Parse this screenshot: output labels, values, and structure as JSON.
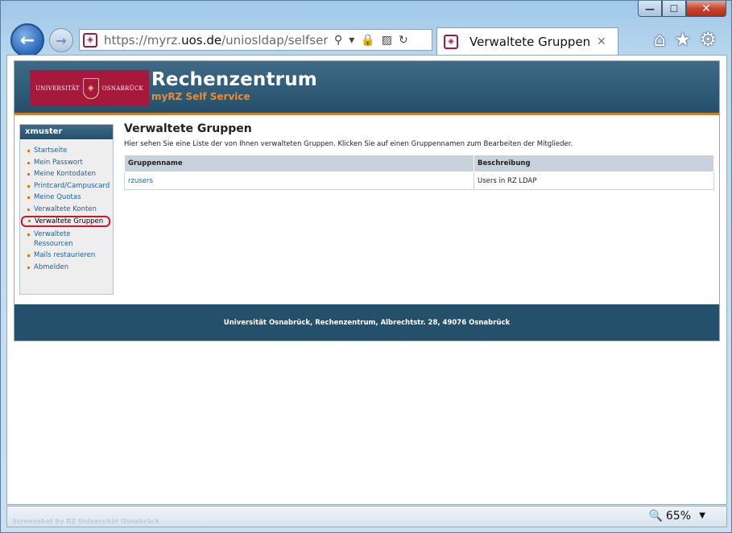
{
  "browser": {
    "url_prefix": "https://myrz.",
    "url_domain": "uos.de",
    "url_path": "/uniosldap/selfservice/",
    "tab_title": "Verwaltete Gruppen...",
    "zoom": "65%",
    "watermark": "Screenshot by RZ Universität Osnabrück"
  },
  "icons": {
    "back": "←",
    "forward": "→",
    "search": "⚲",
    "dropdown": "▾",
    "lock": "🔒",
    "compat": "▨",
    "refresh": "↻",
    "close": "✕",
    "home": "⌂",
    "star": "★",
    "gear": "⚙",
    "minimize": "—",
    "maximize": "☐",
    "win_close": "✕",
    "zoom": "🔍",
    "zoom_arrow": "▼",
    "site": "◈"
  },
  "header": {
    "logo_left": "UNIVERSITÄT",
    "logo_right": "OSNABRÜCK",
    "title": "Rechenzentrum",
    "subtitle": "myRZ Self Service"
  },
  "sidebar": {
    "user": "xmuster",
    "items": [
      {
        "label": "Startseite"
      },
      {
        "label": "Mein Passwort"
      },
      {
        "label": "Meine Kontodaten"
      },
      {
        "label": "Printcard/Campuscard"
      },
      {
        "label": "Meine Quotas"
      },
      {
        "label": "Verwaltete Konten"
      },
      {
        "label": "Verwaltete Gruppen"
      },
      {
        "label": "Verwaltete Ressourcen"
      },
      {
        "label": "Mails restaurieren"
      },
      {
        "label": "Abmelden"
      }
    ]
  },
  "main": {
    "title": "Verwaltete Gruppen",
    "description": "Hier sehen Sie eine Liste der von Ihnen verwalteten Gruppen. Klicken Sie auf einen Gruppennamen zum Bearbeiten der Mitglieder.",
    "table": {
      "headers": [
        "Gruppenname",
        "Beschreibung"
      ],
      "rows": [
        {
          "name": "rzusers",
          "description": "Users in RZ LDAP"
        }
      ]
    }
  },
  "footer": {
    "text": "Universität Osnabrück, Rechenzentrum, Albrechtstr. 28, 49076 Osnabrück"
  }
}
